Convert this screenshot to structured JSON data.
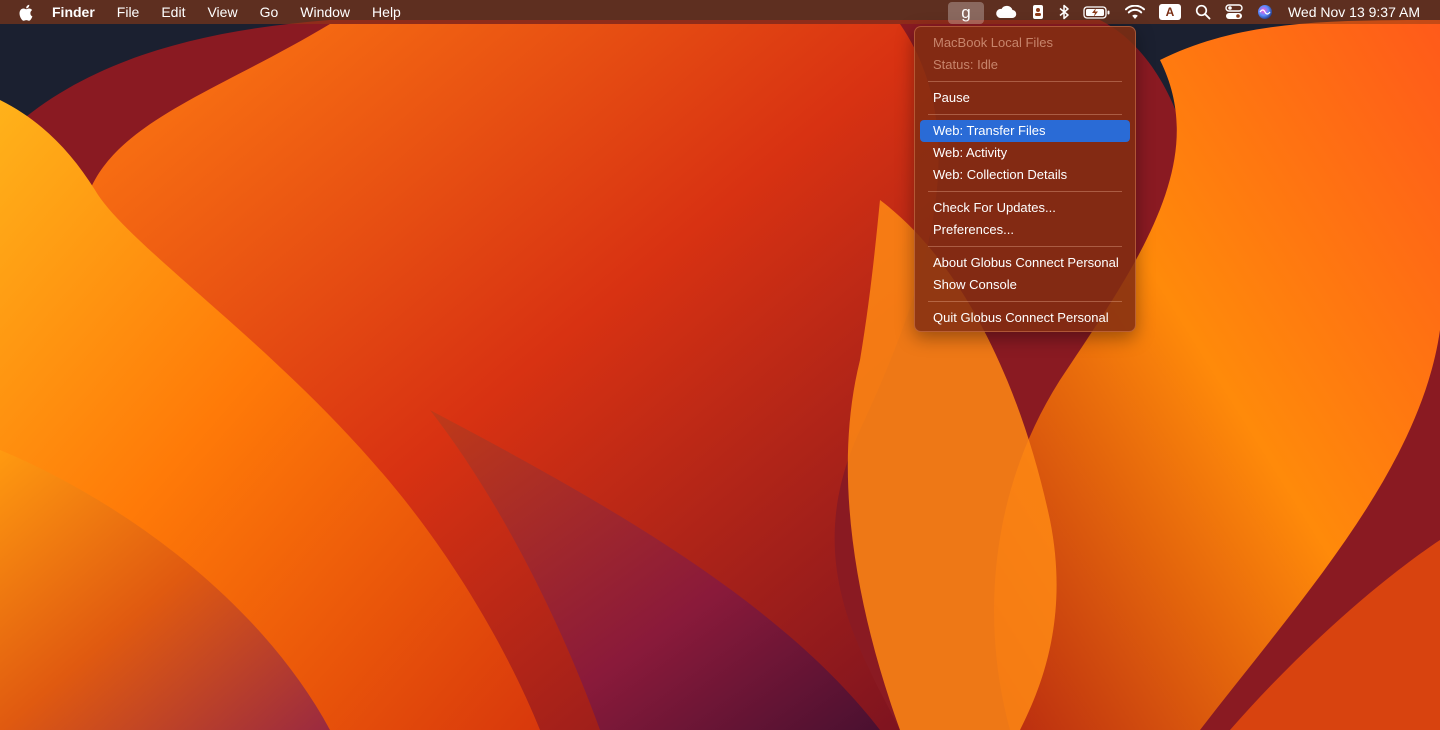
{
  "menubar": {
    "apple_icon": "apple-logo-icon",
    "app_name": "Finder",
    "menus": [
      "File",
      "Edit",
      "View",
      "Go",
      "Window",
      "Help"
    ],
    "status_icons": [
      "globus-icon",
      "creative-cloud-icon",
      "contacts-icon",
      "bluetooth-icon",
      "battery-charging-icon",
      "wifi-icon",
      "input-source-icon",
      "spotlight-icon",
      "control-center-icon",
      "siri-icon"
    ],
    "globus_glyph": "g",
    "input_source_label": "A",
    "clock": "Wed Nov 13  9:37 AM"
  },
  "dropdown": {
    "header_title": "MacBook Local Files",
    "header_status": "Status: Idle",
    "pause": "Pause",
    "web_transfer": "Web: Transfer Files",
    "web_activity": "Web: Activity",
    "web_collection": "Web: Collection Details",
    "check_updates": "Check For Updates...",
    "preferences": "Preferences...",
    "about": "About Globus Connect Personal",
    "show_console": "Show Console",
    "quit": "Quit Globus Connect Personal"
  },
  "colors": {
    "menu_highlight": "#2a6bd6",
    "wallpaper_orange": "#ff8a00",
    "wallpaper_red": "#c82a10",
    "wallpaper_dark": "#1a1f2e"
  }
}
